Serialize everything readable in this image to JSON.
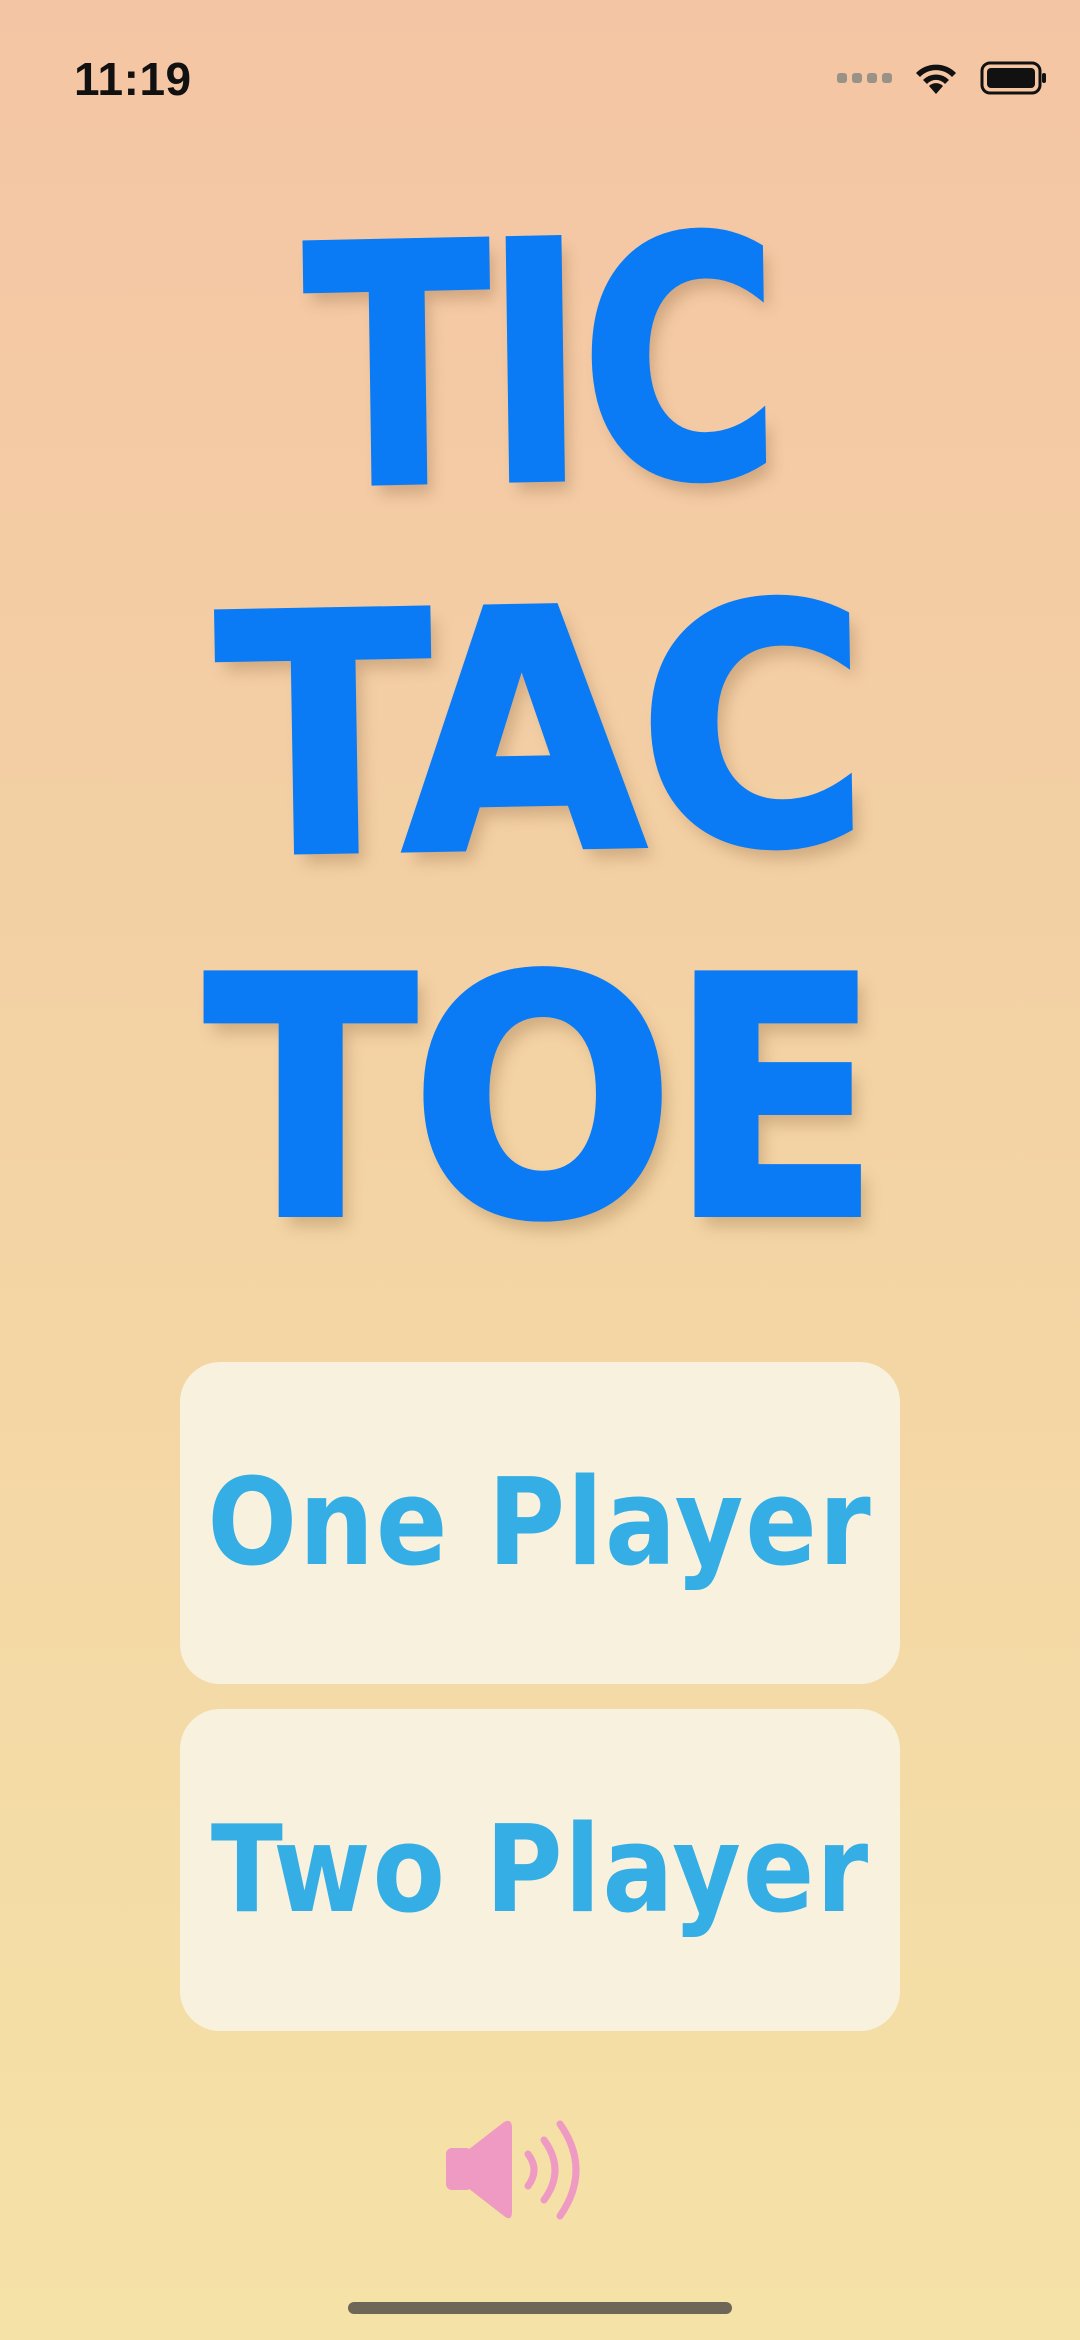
{
  "status_bar": {
    "time": "11:19",
    "icons": [
      "signal-icon",
      "wifi-icon",
      "battery-icon"
    ]
  },
  "title": {
    "lines": [
      "TIC",
      "TAC",
      "TOE"
    ]
  },
  "menu": {
    "one_player_label": "One Player",
    "two_player_label": "Two Player"
  },
  "sound": {
    "icon": "speaker-icon",
    "state": "on"
  },
  "colors": {
    "title_blue": "#0A7AF5",
    "button_text": "#35AEE6",
    "button_bg": "#F8F1DD",
    "speaker_pink": "#EE9AC3",
    "background_top": "#F4C5A4",
    "background_bottom": "#F5E2A7"
  }
}
